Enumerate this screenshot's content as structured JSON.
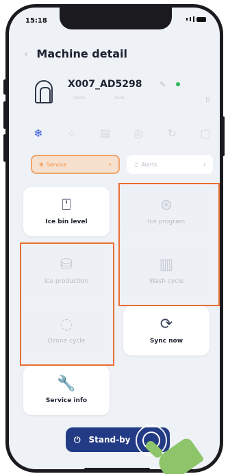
{
  "status_bar": {
    "time": "15:18"
  },
  "header": {
    "title": "Machine detail"
  },
  "machine": {
    "id": "X007_AD5298",
    "meta_left": "Cliente\n-",
    "meta_right": "Serial\n-",
    "meta_far": "B"
  },
  "icon_row": [
    "snowflake-icon",
    "bubbles-icon",
    "document-icon",
    "ozone-icon",
    "cycle-icon",
    "wash-icon"
  ],
  "tabs": {
    "service": "Service",
    "alerts": "Alerts"
  },
  "cards": {
    "ice_bin_level": "Ice bin level",
    "ice_program": "Ice program",
    "ice_production": "Ice production",
    "wash_cycle": "Wash cycle",
    "ozone_cycle": "Ozone cycle",
    "sync_now": "Sync now",
    "service_info": "Service info"
  },
  "standby": {
    "label": "Stand-by"
  },
  "colors": {
    "accent": "#233b84",
    "highlight": "#e86e32",
    "service_tab": "#f28b3c",
    "status_ok": "#2fb85b"
  }
}
